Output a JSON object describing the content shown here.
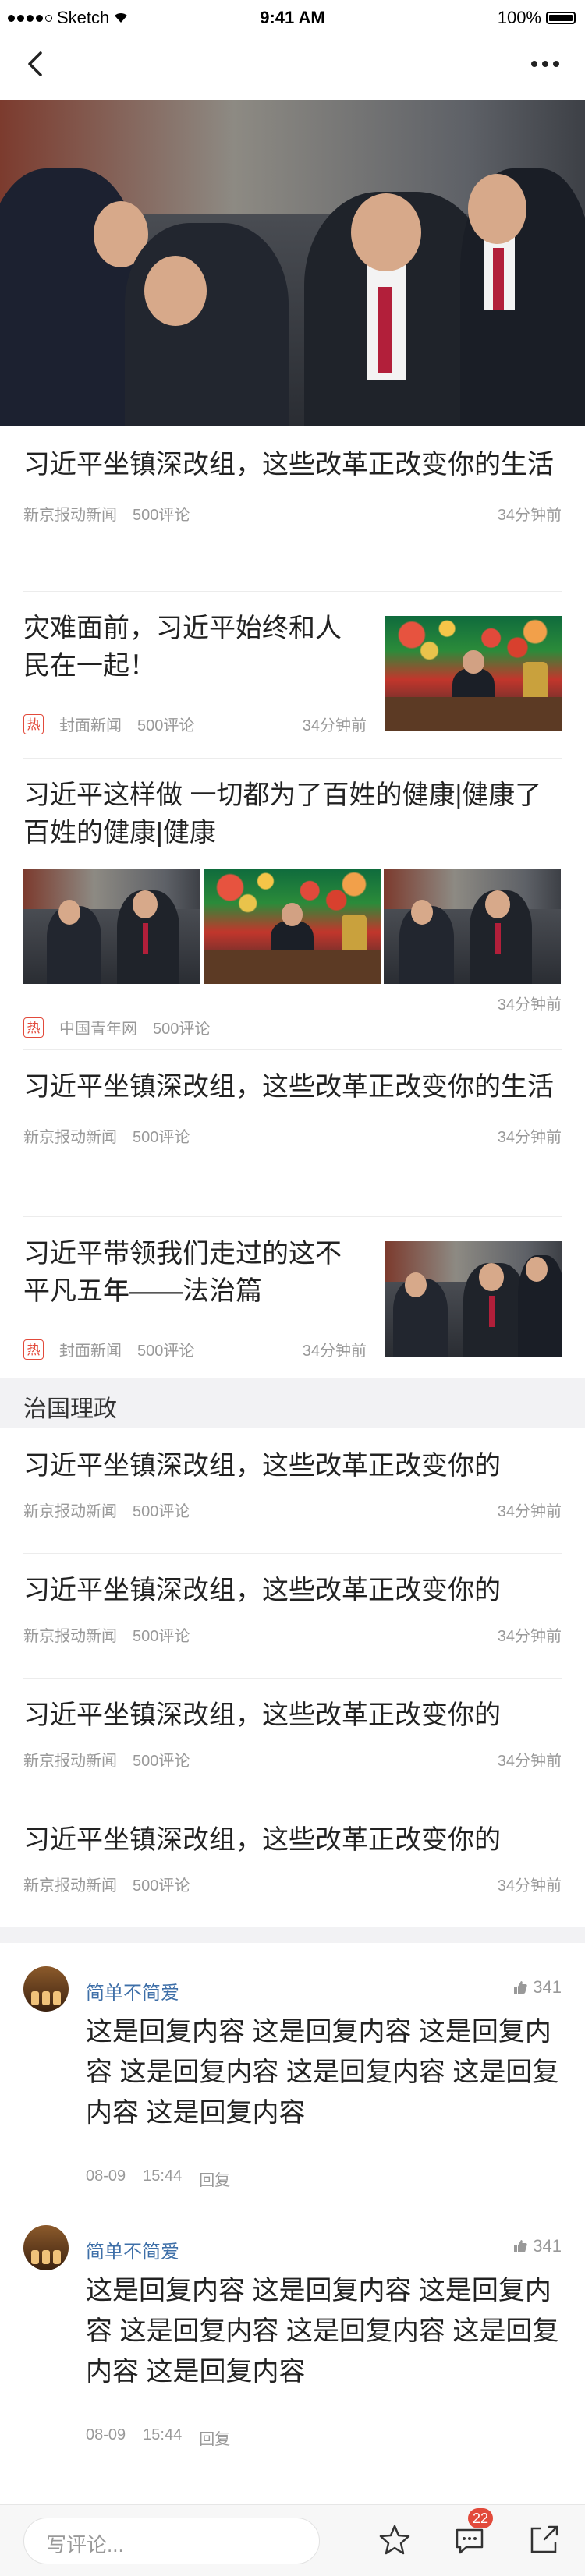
{
  "status_bar": {
    "carrier": "Sketch",
    "time": "9:41 AM",
    "battery": "100%"
  },
  "nav": {
    "back_icon": "back-icon",
    "more_icon": "more-icon"
  },
  "articles": [
    {
      "title": "习近平坐镇深改组，这些改革正改变你的生活",
      "source": "新京报动新闻",
      "comments": "500评论",
      "time": "34分钟前"
    },
    {
      "title": "灾难面前，习近平始终和人民在一起！",
      "hot": "热",
      "source": "封面新闻",
      "comments": "500评论",
      "time": "34分钟前"
    },
    {
      "title": "习近平这样做   一切都为了百姓的健康|健康了百姓的健康|健康",
      "hot": "热",
      "source": "中国青年网",
      "comments": "500评论",
      "time": "34分钟前"
    },
    {
      "title": "习近平坐镇深改组，这些改革正改变你的生活",
      "source": "新京报动新闻",
      "comments": "500评论",
      "time": "34分钟前"
    },
    {
      "title": "习近平带领我们走过的这不平凡五年——法治篇",
      "hot": "热",
      "source": "封面新闻",
      "comments": "500评论",
      "time": "34分钟前"
    }
  ],
  "section": {
    "title": "治国理政",
    "items": [
      {
        "title": "习近平坐镇深改组，这些改革正改变你的",
        "source": "新京报动新闻",
        "comments": "500评论",
        "time": "34分钟前"
      },
      {
        "title": "习近平坐镇深改组，这些改革正改变你的",
        "source": "新京报动新闻",
        "comments": "500评论",
        "time": "34分钟前"
      },
      {
        "title": "习近平坐镇深改组，这些改革正改变你的",
        "source": "新京报动新闻",
        "comments": "500评论",
        "time": "34分钟前"
      },
      {
        "title": "习近平坐镇深改组，这些改革正改变你的",
        "source": "新京报动新闻",
        "comments": "500评论",
        "time": "34分钟前"
      }
    ]
  },
  "comments": [
    {
      "user": "简单不简爱",
      "likes": "341",
      "body": "这是回复内容 这是回复内容 这是回复内容 这是回复内容 这是回复内容 这是回复内容 这是回复内容",
      "date": "08-09",
      "time": "15:44",
      "reply": "回复"
    },
    {
      "user": "简单不简爱",
      "likes": "341",
      "body": "这是回复内容 这是回复内容 这是回复内容 这是回复内容 这是回复内容 这是回复内容 这是回复内容",
      "date": "08-09",
      "time": "15:44",
      "reply": "回复"
    }
  ],
  "bottom_bar": {
    "placeholder": "写评论...",
    "comment_count": "22"
  },
  "colors": {
    "accent_red": "#e24a3b",
    "link_blue": "#3e6fa8",
    "meta_gray": "#999999"
  }
}
